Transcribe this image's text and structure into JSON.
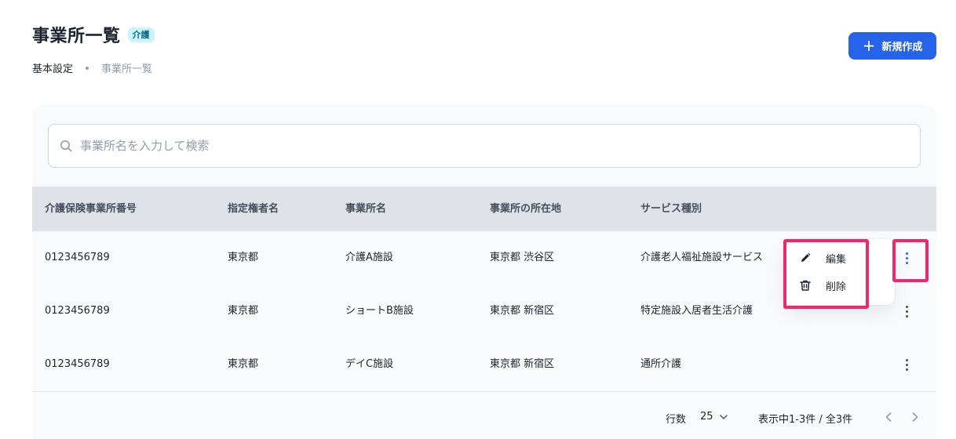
{
  "header": {
    "title": "事業所一覧",
    "badge": "介護",
    "breadcrumb": [
      "基本設定",
      "事業所一覧"
    ]
  },
  "actions": {
    "create_label": "新規作成"
  },
  "search": {
    "placeholder": "事業所名を入力して検索",
    "value": ""
  },
  "table": {
    "columns": [
      "介護保険事業所番号",
      "指定権者名",
      "事業所名",
      "事業所の所在地",
      "サービス種別"
    ],
    "rows": [
      [
        "0123456789",
        "東京都",
        "介護A施設",
        "東京都 渋谷区",
        "介護老人福祉施設サービス"
      ],
      [
        "0123456789",
        "東京都",
        "ショートB施設",
        "東京都 新宿区",
        "特定施設入居者生活介護"
      ],
      [
        "0123456789",
        "東京都",
        "デイC施設",
        "東京都 新宿区",
        "通所介護"
      ]
    ]
  },
  "row_menu": {
    "edit_label": "編集",
    "delete_label": "削除"
  },
  "pagination": {
    "rows_label": "行数",
    "rows_per_page": "25",
    "range_text": "表示中1-3件 / 全3件"
  },
  "colors": {
    "primary": "#2563eb",
    "highlight": "#f0266f",
    "badge_bg": "#caf3fb"
  }
}
